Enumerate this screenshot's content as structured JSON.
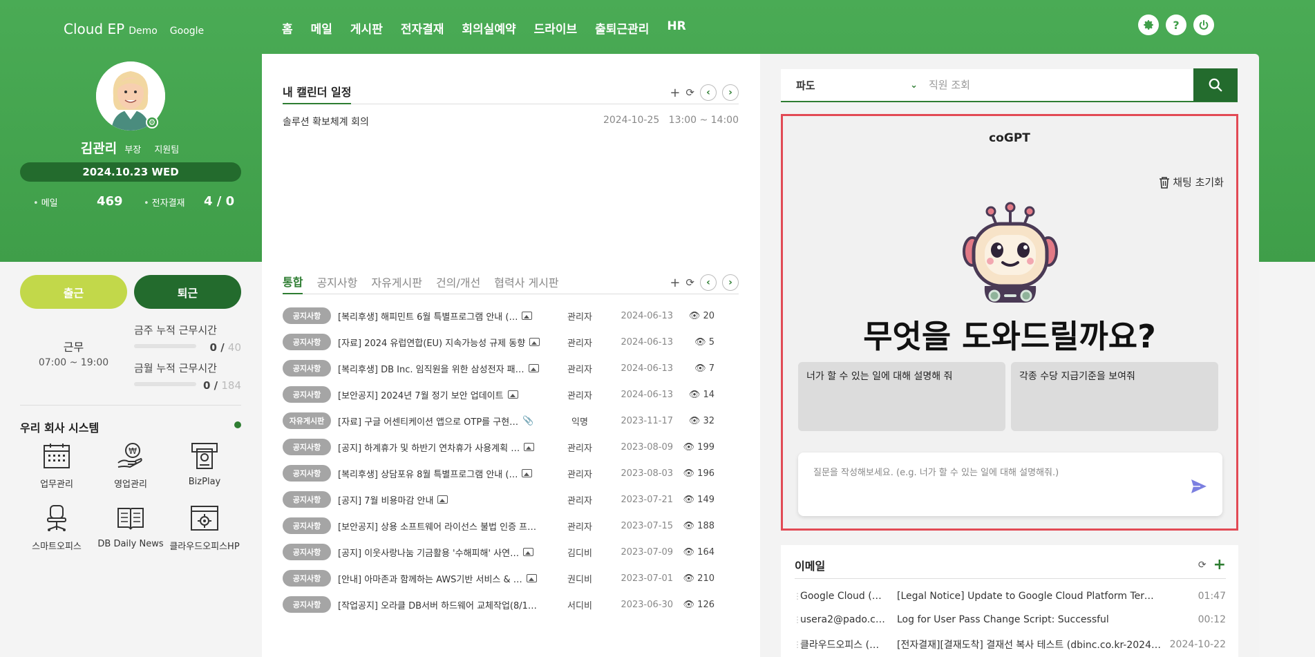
{
  "header": {
    "brand": "Cloud EP",
    "brand_sub": "Demo",
    "brand_google": "Google",
    "nav": [
      "홈",
      "메일",
      "게시판",
      "전자결재",
      "회의실예약",
      "드라이브",
      "출퇴근관리",
      "HR"
    ],
    "icons": [
      "gear-icon",
      "help-icon",
      "power-icon"
    ]
  },
  "profile": {
    "name": "김관리",
    "rank": "부장",
    "team": "지원팀",
    "date": "2024.10.23 WED",
    "mail_label": "메일",
    "mail_count": "469",
    "approval_label": "전자결재",
    "approval_count": "4 / 0"
  },
  "attendance": {
    "in_label": "출근",
    "out_label": "퇴근",
    "work_type": "근무",
    "work_hours": "07:00 ~ 19:00",
    "week_label": "금주 누적 근무시간",
    "week_value": "0 /",
    "week_total": "40",
    "week_progress": 0,
    "month_label": "금월 누적 근무시간",
    "month_value": "0 /",
    "month_total": "184",
    "month_progress": 0
  },
  "systems": {
    "title": "우리 회사 시스템",
    "items": [
      {
        "label": "업무관리",
        "icon": "calendar-icon"
      },
      {
        "label": "영업관리",
        "icon": "money-hand-icon"
      },
      {
        "label": "BizPlay",
        "icon": "atm-icon"
      },
      {
        "label": "스마트오피스",
        "icon": "office-chair-icon"
      },
      {
        "label": "DB Daily News",
        "icon": "book-icon"
      },
      {
        "label": "클라우드오피스HP",
        "icon": "web-settings-icon"
      }
    ]
  },
  "calendar": {
    "title": "내 캘린더 일정",
    "events": [
      {
        "title": "솔루션 확보체계 회의",
        "date": "2024-10-25",
        "time": "13:00 ~ 14:00"
      }
    ]
  },
  "board": {
    "tabs": [
      "통합",
      "공지사항",
      "자유게시판",
      "건의/개선",
      "협력사 게시판"
    ],
    "rows": [
      {
        "badge": "공지사항",
        "title": "[복리후생] 해피민트 6월 특별프로그램 안내 (…",
        "attach": "image",
        "author": "관리자",
        "date": "2024-06-13",
        "views": "20"
      },
      {
        "badge": "공지사항",
        "title": "[자료] 2024 유럽연합(EU) 지속가능성 규제 동향",
        "attach": "image",
        "author": "관리자",
        "date": "2024-06-13",
        "views": "5"
      },
      {
        "badge": "공지사항",
        "title": "[복리후생] DB Inc. 임직원을 위한 삼성전자 패…",
        "attach": "image",
        "author": "관리자",
        "date": "2024-06-13",
        "views": "7"
      },
      {
        "badge": "공지사항",
        "title": "[보안공지] 2024년 7월 정기 보안 업데이트",
        "attach": "image",
        "author": "관리자",
        "date": "2024-06-13",
        "views": "14"
      },
      {
        "badge": "자유게시판",
        "title": "[자료] 구글 어센티케이션 앱으로 OTP를 구현…",
        "attach": "clip",
        "author": "익명",
        "date": "2023-11-17",
        "views": "32"
      },
      {
        "badge": "공지사항",
        "title": "[공지] 하계휴가 및 하반기 연차휴가 사용계획 …",
        "attach": "image",
        "author": "관리자",
        "date": "2023-08-09",
        "views": "199"
      },
      {
        "badge": "공지사항",
        "title": "[복리후생] 상담포유 8월 특별프로그램 안내 (…",
        "attach": "image",
        "author": "관리자",
        "date": "2023-08-03",
        "views": "196"
      },
      {
        "badge": "공지사항",
        "title": "[공지] 7월 비용마감 안내",
        "attach": "image",
        "author": "관리자",
        "date": "2023-07-21",
        "views": "149"
      },
      {
        "badge": "공지사항",
        "title": "[보안공지] 상용 소프트웨어 라이선스 불법 인증 프…",
        "attach": "",
        "author": "관리자",
        "date": "2023-07-15",
        "views": "188"
      },
      {
        "badge": "공지사항",
        "title": "[공지] 이웃사랑나눔 기금활용 '수해피해' 사연…",
        "attach": "image",
        "author": "김디비",
        "date": "2023-07-09",
        "views": "164"
      },
      {
        "badge": "공지사항",
        "title": "[안내] 아마존과 함께하는 AWS기반 서비스 & …",
        "attach": "image",
        "author": "권디비",
        "date": "2023-07-01",
        "views": "210"
      },
      {
        "badge": "공지사항",
        "title": "[작업공지] 오라클 DB서버 하드웨어 교체작업(8/1…",
        "attach": "",
        "author": "서디비",
        "date": "2023-06-30",
        "views": "126"
      }
    ]
  },
  "search": {
    "scope": "파도",
    "placeholder": "직원 조회"
  },
  "cogpt": {
    "title": "coGPT",
    "reset_label": "채팅 초기화",
    "headline": "무엇을 도와드릴까요?",
    "suggestions": [
      "너가 할 수 있는 일에 대해 설명해 줘",
      "각종 수당 지급기준을 보여줘"
    ],
    "input_placeholder": "질문을 작성해보세요. (e.g. 너가 할 수 있는 일에 대해 설명해줘.)"
  },
  "email": {
    "title": "이메일",
    "rows": [
      {
        "from": "Google Cloud (…",
        "subject": "[Legal Notice] Update to Google Cloud Platform Terms o…",
        "time": "01:47"
      },
      {
        "from": "usera2@pado.c…",
        "subject": "Log for User Pass Change Script: Successful",
        "time": "00:12"
      },
      {
        "from": "클라우드오피스 (…",
        "subject": "[전자결재][결재도착] 결재선 복사 테스트 (dbinc.co.kr-2024…",
        "time": "2024-10-22"
      }
    ]
  },
  "colors": {
    "brand_green": "#3f9e49",
    "dark_green": "#236b2d",
    "lime": "#c2d84a",
    "highlight_red": "#e24a55"
  }
}
